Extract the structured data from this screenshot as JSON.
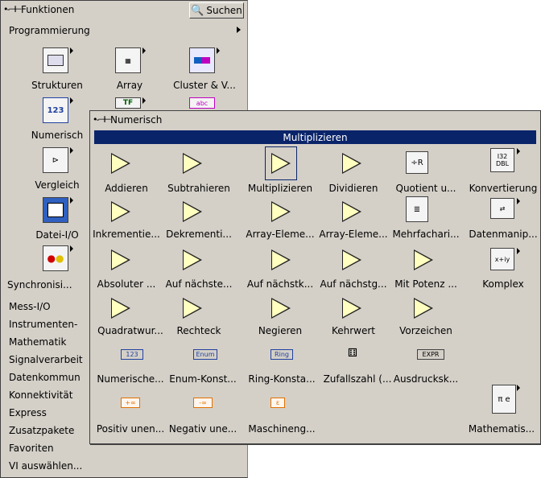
{
  "functions_palette": {
    "title": "Funktionen",
    "search_label": "Suchen",
    "breadcrumb": "Programmierung",
    "icons": {
      "strukturen": "Strukturen",
      "array": "Array",
      "cluster": "Cluster & V...",
      "numerisch": "Numerisch",
      "vergleich": "Vergleich",
      "datei": "Datei-I/O",
      "synchron": "Synchronisi..."
    },
    "list": [
      "Mess-I/O",
      "Instrumenten-",
      "Mathematik",
      "Signalverarbeit",
      "Datenkommun",
      "Konnektivität",
      "Express",
      "Zusatzpakete",
      "Favoriten",
      "VI auswählen..."
    ]
  },
  "numeric_palette": {
    "title": "Numerisch",
    "header": "Multiplizieren",
    "items": [
      "Addieren",
      "Subtrahieren",
      "Multiplizieren",
      "Dividieren",
      "Quotient u...",
      "Konvertierung",
      "Inkrementie...",
      "Dekrementi...",
      "Array-Eleme...",
      "Array-Eleme...",
      "Mehrfachari...",
      "Datenmanip...",
      "Absoluter ...",
      "Auf nächste...",
      "Auf nächstk...",
      "Auf nächstg...",
      "Mit Potenz ...",
      "Komplex",
      "Quadratwur...",
      "Rechteck",
      "Negieren",
      "Kehrwert",
      "Vorzeichen",
      "Numerische...",
      "Enum-Konst...",
      "Ring-Konsta...",
      "Zufallszahl (...",
      "Ausdrucksk...",
      "Positiv unen...",
      "Negativ une...",
      "Maschineng...",
      "Mathematis..."
    ],
    "glyphs": {
      "num123": "123",
      "enum": "Enum",
      "ring": "Ring",
      "expr": "EXPR",
      "pos_inf": "+∞",
      "neg_inf": "-∞",
      "eps": "ε",
      "i32": "I32",
      "dbl": "DBL"
    }
  },
  "colors": {
    "palette_bg": "#d4d0c8",
    "header_bg": "#0a246a"
  }
}
